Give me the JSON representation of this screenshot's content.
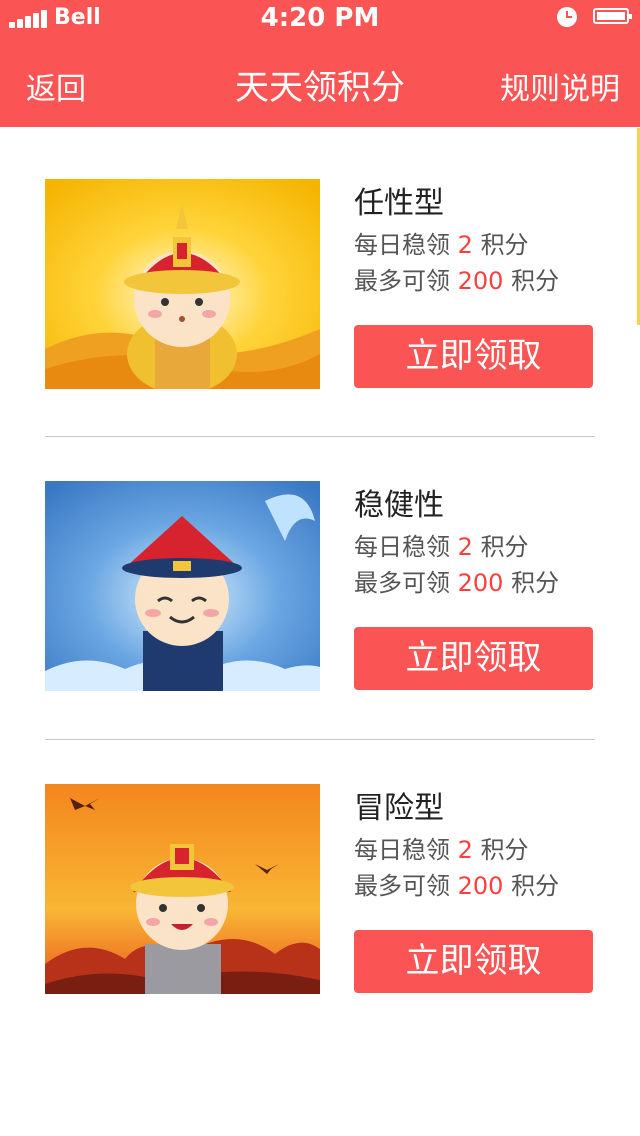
{
  "status_bar": {
    "carrier": "Bell",
    "time": "4:20 PM"
  },
  "nav": {
    "back_label": "返回",
    "title": "天天领积分",
    "rules_label": "规则说明"
  },
  "products": [
    {
      "name": "任性型",
      "daily_prefix": "每日稳领",
      "daily_value": "2",
      "daily_suffix": "积分",
      "max_prefix": "最多可领",
      "max_value": "200",
      "max_suffix": "积分",
      "button_label": "立即领取"
    },
    {
      "name": "稳健性",
      "daily_prefix": "每日稳领",
      "daily_value": "2",
      "daily_suffix": "积分",
      "max_prefix": "最多可领",
      "max_value": "200",
      "max_suffix": "积分",
      "button_label": "立即领取"
    },
    {
      "name": "冒险型",
      "daily_prefix": "每日稳领",
      "daily_value": "2",
      "daily_suffix": "积分",
      "max_prefix": "最多可领",
      "max_value": "200",
      "max_suffix": "积分",
      "button_label": "立即领取"
    }
  ],
  "colors": {
    "accent": "#fa5454",
    "highlight": "#ff3e3e",
    "scroll_indicator": "#f3d44b"
  }
}
